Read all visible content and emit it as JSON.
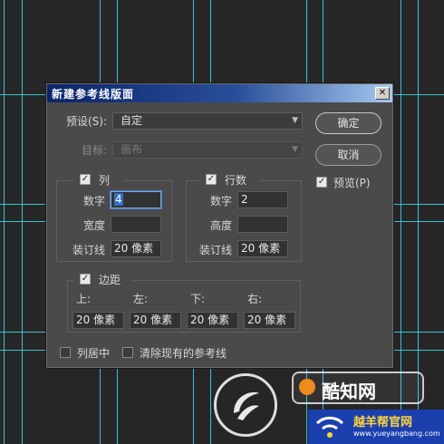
{
  "dialog": {
    "title": "新建参考线版面",
    "close_glyph": "✕",
    "preset_label": "预设(S):",
    "preset_value": "自定",
    "target_label": "目标:",
    "target_value": "画布",
    "ok_label": "确定",
    "cancel_label": "取消",
    "preview_label": "预览(P)",
    "preview_checked": true
  },
  "columns": {
    "label": "列",
    "checked": true,
    "number_label": "数字",
    "number_value": "4",
    "width_label": "宽度",
    "width_value": "",
    "gutter_label": "装订线",
    "gutter_value": "20 像素"
  },
  "rows": {
    "label": "行数",
    "checked": true,
    "number_label": "数字",
    "number_value": "2",
    "height_label": "高度",
    "height_value": "",
    "gutter_label": "装订线",
    "gutter_value": "20 像素"
  },
  "margin": {
    "label": "边距",
    "checked": true,
    "top_label": "上:",
    "left_label": "左:",
    "bottom_label": "下:",
    "right_label": "右:",
    "top_value": "20 像素",
    "left_value": "20 像素",
    "bottom_value": "20 像素",
    "right_value": "20 像素"
  },
  "options": {
    "center_columns_label": "列居中",
    "center_columns_checked": false,
    "clear_guides_label": "清除现有的参考线",
    "clear_guides_checked": false
  },
  "watermark": {
    "brand_name": "酷知网",
    "brand_sub": "越羊帮官网",
    "brand_url": "www.yueyangbang.com"
  },
  "colors": {
    "guide": "#3bd3e6",
    "canvas": "#262626",
    "dialog_bg": "#4a4a4a",
    "titlebar_start": "#0a246a",
    "titlebar_end": "#a6caf0"
  }
}
